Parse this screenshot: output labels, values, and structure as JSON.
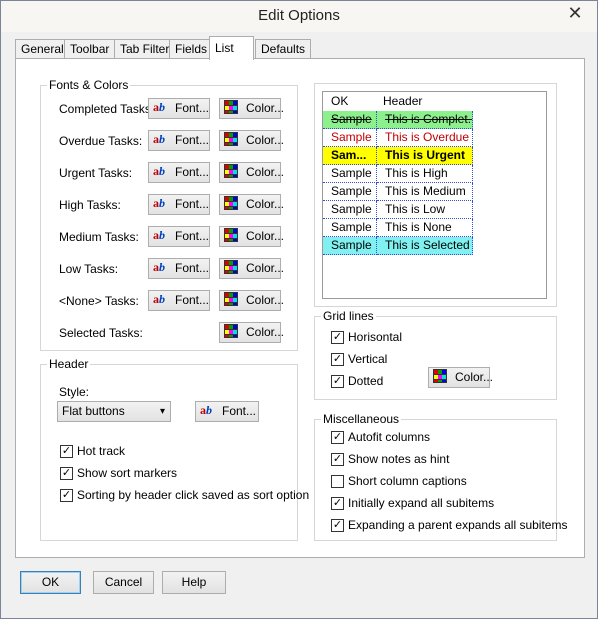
{
  "window": {
    "title": "Edit Options",
    "close_glyph": "✕"
  },
  "tabs": [
    "General",
    "Toolbar",
    "Tab Filter",
    "Fields",
    "List",
    "Defaults"
  ],
  "fonts_colors": {
    "title": "Fonts & Colors",
    "font_label": "Font...",
    "color_label": "Color...",
    "rows": [
      "Completed Tasks:",
      "Overdue Tasks:",
      "Urgent Tasks:",
      "High Tasks:",
      "Medium Tasks:",
      "Low Tasks:",
      "<None> Tasks:",
      "Selected Tasks:"
    ]
  },
  "header_group": {
    "title": "Header",
    "style_label": "Style:",
    "style_value": "Flat buttons",
    "font_label": "Font...",
    "checks": [
      {
        "label": "Hot track",
        "checked": true
      },
      {
        "label": "Show sort markers",
        "checked": true
      },
      {
        "label": "Sorting by header click saved as sort option",
        "checked": true
      }
    ]
  },
  "preview": {
    "columns": [
      "OK",
      "Header"
    ],
    "rows": [
      {
        "c1": "Sample",
        "c2": "This is Complet...",
        "bg": "#8cf08c",
        "fg": "#000000",
        "style": "strike"
      },
      {
        "c1": "Sample",
        "c2": "This is Overdue",
        "bg": "#ffffff",
        "fg": "#c00000",
        "style": "normal"
      },
      {
        "c1": "Sam...",
        "c2": "This is Urgent",
        "bg": "#ffff00",
        "fg": "#000000",
        "style": "bold"
      },
      {
        "c1": "Sample",
        "c2": "This is High",
        "bg": "#ffffff",
        "fg": "#000000",
        "style": "normal"
      },
      {
        "c1": "Sample",
        "c2": "This is Medium",
        "bg": "#ffffff",
        "fg": "#000000",
        "style": "normal"
      },
      {
        "c1": "Sample",
        "c2": "This is Low",
        "bg": "#ffffff",
        "fg": "#000000",
        "style": "normal"
      },
      {
        "c1": "Sample",
        "c2": "This is None",
        "bg": "#ffffff",
        "fg": "#000000",
        "style": "normal"
      },
      {
        "c1": "Sample",
        "c2": "This is Selected",
        "bg": "#80f0f0",
        "fg": "#000000",
        "style": "normal"
      }
    ]
  },
  "grid_lines": {
    "title": "Grid lines",
    "color_label": "Color...",
    "checks": [
      {
        "label": "Horisontal",
        "checked": true
      },
      {
        "label": "Vertical",
        "checked": true
      },
      {
        "label": "Dotted",
        "checked": true
      }
    ]
  },
  "misc": {
    "title": "Miscellaneous",
    "checks": [
      {
        "label": "Autofit columns",
        "checked": true
      },
      {
        "label": "Show notes as hint",
        "checked": true
      },
      {
        "label": "Short column captions",
        "checked": false
      },
      {
        "label": "Initially expand all subitems",
        "checked": true
      },
      {
        "label": "Expanding a parent expands all subitems",
        "checked": true
      }
    ]
  },
  "footer": {
    "ok": "OK",
    "cancel": "Cancel",
    "help": "Help"
  },
  "icons": {
    "font": "font-icon",
    "color": "color-palette-icon",
    "check": "✓",
    "dropdown": "▾"
  }
}
